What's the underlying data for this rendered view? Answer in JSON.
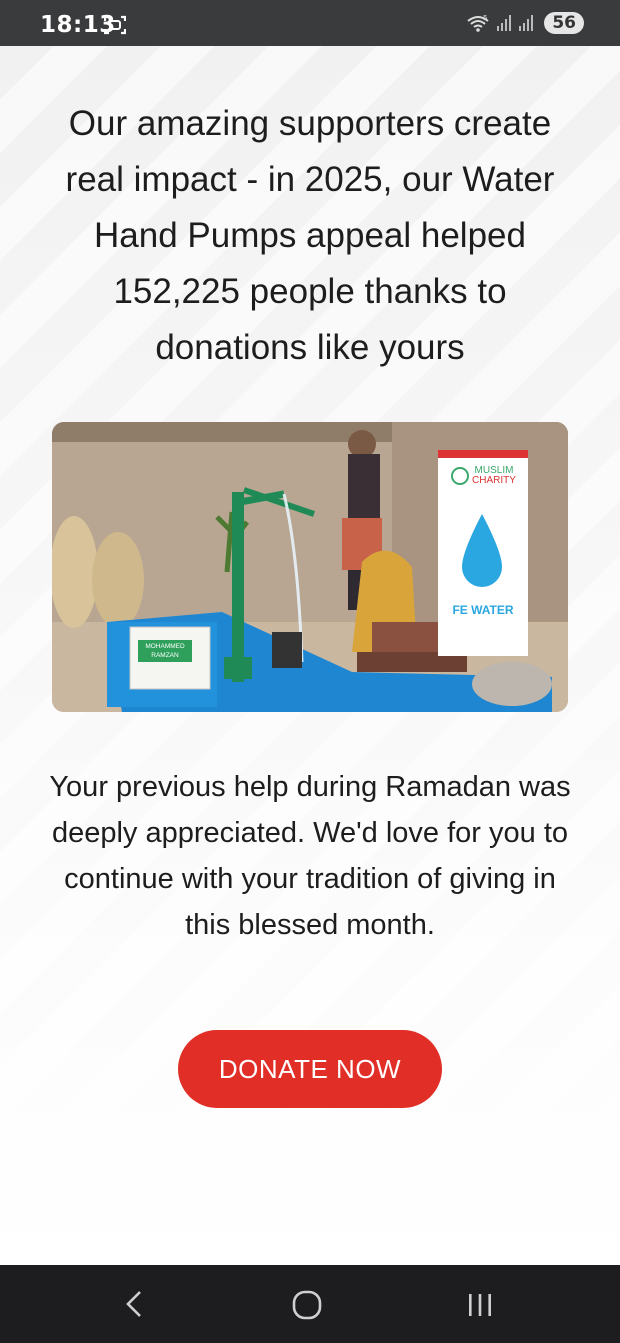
{
  "status_bar": {
    "time": "18:13",
    "battery": "56",
    "icons": [
      "screenshot-icon",
      "wifi-icon",
      "signal-icon",
      "signal-icon"
    ]
  },
  "main": {
    "headline": "Our amazing supporters create real impact - in 2025, our Water Hand Pumps appeal helped 152,225 people thanks to donations like yours",
    "photo": {
      "banner_brand_line1": "MUSLIM",
      "banner_brand_line2": "CHARITY",
      "banner_caption": "FE WATER",
      "plaque_line1": "MOHAMMED",
      "plaque_line2": "RAMZAN"
    },
    "body": "Your previous help during Ramadan was deeply appreciated. We'd love for you to continue with your tradition of giving in this blessed month.",
    "donate_label": "DONATE NOW"
  },
  "nav_bar": {
    "icons": [
      "back-icon",
      "home-icon",
      "recents-icon"
    ]
  },
  "colors": {
    "accent": "#e12e26",
    "status_bar": "#3a3b3d",
    "nav_bar": "#1d1d1f",
    "pump_green": "#1f8a55",
    "platform_blue": "#1f86d1"
  }
}
